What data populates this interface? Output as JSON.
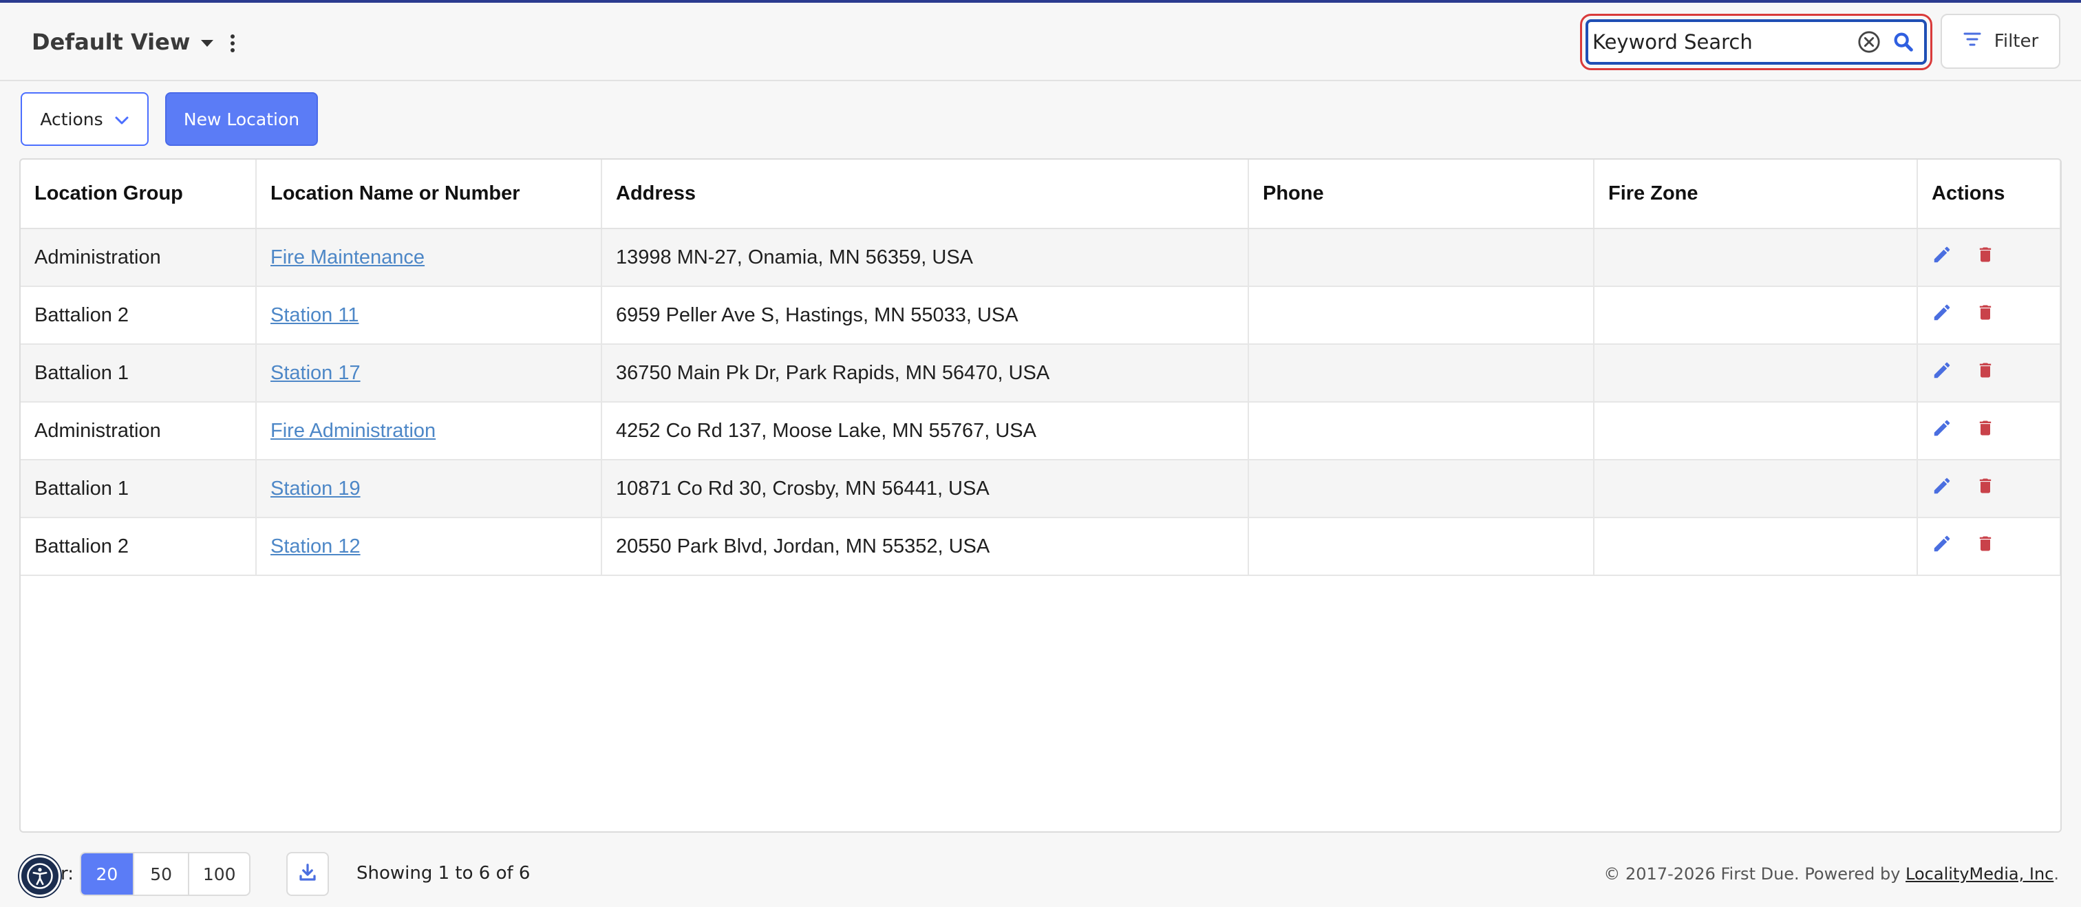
{
  "header": {
    "view_title": "Default View",
    "search": {
      "placeholder": "Keyword Search"
    },
    "filter_label": "Filter"
  },
  "toolbar": {
    "actions_label": "Actions",
    "new_location_label": "New Location"
  },
  "table": {
    "columns": [
      "Location Group",
      "Location Name or Number",
      "Address",
      "Phone",
      "Fire Zone",
      "Actions"
    ],
    "rows": [
      {
        "group": "Administration",
        "name": "Fire Maintenance",
        "address": "13998 MN-27, Onamia, MN 56359, USA",
        "phone": "",
        "fire_zone": ""
      },
      {
        "group": "Battalion 2",
        "name": "Station 11",
        "address": "6959 Peller Ave S, Hastings, MN 55033, USA",
        "phone": "",
        "fire_zone": ""
      },
      {
        "group": "Battalion 1",
        "name": "Station 17",
        "address": "36750 Main Pk Dr, Park Rapids, MN 56470, USA",
        "phone": "",
        "fire_zone": ""
      },
      {
        "group": "Administration",
        "name": "Fire Administration",
        "address": "4252 Co Rd 137, Moose Lake, MN 55767, USA",
        "phone": "",
        "fire_zone": ""
      },
      {
        "group": "Battalion 1",
        "name": "Station 19",
        "address": "10871 Co Rd 30, Crosby, MN 56441, USA",
        "phone": "",
        "fire_zone": ""
      },
      {
        "group": "Battalion 2",
        "name": "Station 12",
        "address": "20550 Park Blvd, Jordan, MN 55352, USA",
        "phone": "",
        "fire_zone": ""
      }
    ]
  },
  "footer": {
    "per_page_label": "r:",
    "per_page_options": [
      "20",
      "50",
      "100"
    ],
    "selected_per_page": "20",
    "showing_text": "Showing 1 to 6 of 6",
    "copyright_prefix": "© 2017-2026 First Due. Powered by ",
    "copyright_link": "LocalityMedia, Inc",
    "copyright_suffix": "."
  },
  "colors": {
    "primary": "#5b7cf6",
    "edit_icon": "#4a6ee0",
    "delete_icon": "#c9424a",
    "link": "#4d87c7",
    "search_outline": "#d93a3a"
  },
  "icons": {
    "view_caret": "chevron-down-icon",
    "view_menu": "kebab-icon",
    "search_clear": "close-circle-icon",
    "search": "search-icon",
    "filter": "filter-icon",
    "actions_caret": "chevron-down-icon",
    "row_edit": "pencil-icon",
    "row_delete": "trash-icon",
    "download": "download-icon",
    "accessibility": "accessibility-icon"
  }
}
